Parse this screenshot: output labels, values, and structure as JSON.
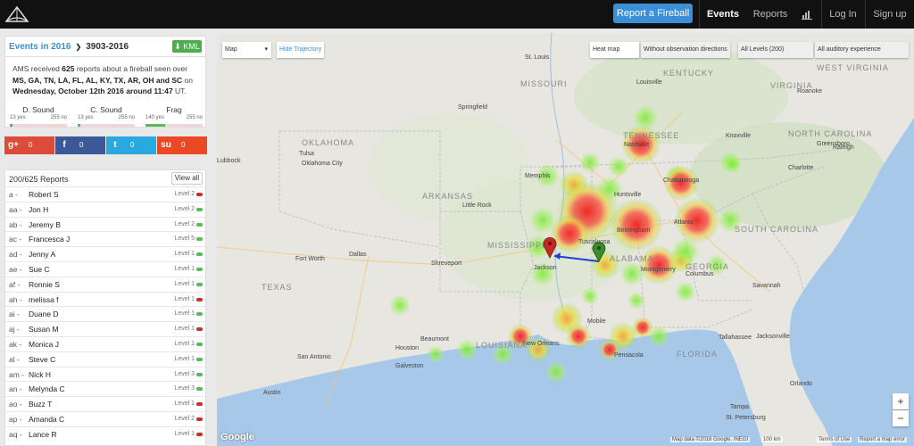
{
  "navbar": {
    "report_button": "Report a Fireball",
    "events": "Events",
    "reports": "Reports",
    "login": "Log In",
    "signup": "Sign up"
  },
  "event": {
    "link": "Events in 2016",
    "id": "3903-2016",
    "kml": "KML",
    "summary_prefix": "AMS received ",
    "count": "625",
    "summary_mid": " reports about a fireball seen over ",
    "states": "MS, GA, TN, LA, FL, AL, KY, TX, AR, OH and SC",
    "summary_on": " on ",
    "date": "Wednesday, October 12th 2016 around 11:47",
    "tz": " UT."
  },
  "meters": [
    {
      "title": "D. Sound",
      "yes": "13 yes",
      "no": "255 no",
      "fill": 0.05
    },
    {
      "title": "C. Sound",
      "yes": "13 yes",
      "no": "255 no",
      "fill": 0.05
    },
    {
      "title": "Frag",
      "yes": "140 yes",
      "no": "255 no",
      "fill": 0.35
    }
  ],
  "share": [
    {
      "icon": "g+",
      "count": "0",
      "color": "#dd4b39"
    },
    {
      "icon": "f",
      "count": "0",
      "color": "#3b5998"
    },
    {
      "icon": "t",
      "count": "0",
      "color": "#2aa9e0"
    },
    {
      "icon": "su",
      "count": "0",
      "color": "#eb4924"
    }
  ],
  "reports": {
    "title": "200/625  Reports",
    "view_all": "View all",
    "rows": [
      {
        "code": "a -",
        "name": "Robert S",
        "level": "Level 2",
        "color": "#c9302c"
      },
      {
        "code": "aa -",
        "name": "Jon H",
        "level": "Level 2",
        "color": "#5cb85c"
      },
      {
        "code": "ab -",
        "name": "Jeremy B",
        "level": "Level 2",
        "color": "#5cb85c"
      },
      {
        "code": "ac -",
        "name": "Francesca J",
        "level": "Level 5",
        "color": "#5cb85c"
      },
      {
        "code": "ad -",
        "name": "Jenny A",
        "level": "Level 1",
        "color": "#5cb85c"
      },
      {
        "code": "ae -",
        "name": "Sue C",
        "level": "Level 1",
        "color": "#5cb85c"
      },
      {
        "code": "af -",
        "name": "Ronnie S",
        "level": "Level 1",
        "color": "#5cb85c"
      },
      {
        "code": "ah -",
        "name": "melissa f",
        "level": "Level 1",
        "color": "#c9302c"
      },
      {
        "code": "ai -",
        "name": "Duane D",
        "level": "Level 1",
        "color": "#5cb85c"
      },
      {
        "code": "aj -",
        "name": "Susan M",
        "level": "Level 1",
        "color": "#c9302c"
      },
      {
        "code": "ak -",
        "name": "Monica J",
        "level": "Level 1",
        "color": "#5cb85c"
      },
      {
        "code": "al -",
        "name": "Steve C",
        "level": "Level 1",
        "color": "#5cb85c"
      },
      {
        "code": "am -",
        "name": "Nick H",
        "level": "Level 3",
        "color": "#5cb85c"
      },
      {
        "code": "an -",
        "name": "Melynda C",
        "level": "Level 3",
        "color": "#5cb85c"
      },
      {
        "code": "ao -",
        "name": "Buzz T",
        "level": "Level 1",
        "color": "#c9302c"
      },
      {
        "code": "ap -",
        "name": "Amanda C",
        "level": "Level 2",
        "color": "#c9302c"
      },
      {
        "code": "aq -",
        "name": "Lance R",
        "level": "Level 1",
        "color": "#c9302c"
      }
    ]
  },
  "map": {
    "type_select": "Map",
    "hide_trajectory": "Hide Trajectory",
    "heat_map": "Heat map",
    "without_obs": "Without observation directions",
    "all_levels": "All Levels (200)",
    "all_auditory": "All auditory experience",
    "zoom_in": "+",
    "zoom_out": "−",
    "google": "Google",
    "attrib_data": "Map data ©2016 Google, INEGI",
    "scale": "100 km",
    "terms": "Terms of Use",
    "report_error": "Report a map error",
    "states": [
      {
        "label": "MISSOURI"
      },
      {
        "label": "KENTUCKY"
      },
      {
        "label": "WEST VIRGINIA"
      },
      {
        "label": "VIRGINIA"
      },
      {
        "label": "TENNESSEE"
      },
      {
        "label": "NORTH CAROLINA"
      },
      {
        "label": "OKLAHOMA"
      },
      {
        "label": "ARKANSAS"
      },
      {
        "label": "SOUTH CAROLINA"
      },
      {
        "label": "MISSISSIPPI"
      },
      {
        "label": "ALABAMA"
      },
      {
        "label": "GEORGIA"
      },
      {
        "label": "TEXAS"
      },
      {
        "label": "LOUISIANA"
      },
      {
        "label": "FLORIDA"
      }
    ],
    "cities": [
      {
        "label": "St. Louis"
      },
      {
        "label": "Springfield"
      },
      {
        "label": "Tulsa"
      },
      {
        "label": "Oklahoma City"
      },
      {
        "label": "Nashville"
      },
      {
        "label": "Memphis"
      },
      {
        "label": "Chattanooga"
      },
      {
        "label": "Huntsville"
      },
      {
        "label": "Atlanta"
      },
      {
        "label": "Birmingham"
      },
      {
        "label": "Tuscaloosa"
      },
      {
        "label": "Jackson"
      },
      {
        "label": "Montgomery"
      },
      {
        "label": "Columbus"
      },
      {
        "label": "Dallas"
      },
      {
        "label": "Fort Worth"
      },
      {
        "label": "Shreveport"
      },
      {
        "label": "Mobile"
      },
      {
        "label": "New Orleans"
      },
      {
        "label": "Pensacola"
      },
      {
        "label": "Tallahassee"
      },
      {
        "label": "Houston"
      },
      {
        "label": "Beaumont"
      },
      {
        "label": "Austin"
      },
      {
        "label": "San Antonio"
      },
      {
        "label": "Savannah"
      },
      {
        "label": "Charlotte"
      },
      {
        "label": "Greensboro"
      },
      {
        "label": "Jacksonville"
      },
      {
        "label": "Orlando"
      },
      {
        "label": "Tampa"
      },
      {
        "label": "St. Petersburg"
      },
      {
        "label": "Raleigh"
      },
      {
        "label": "Knoxville"
      },
      {
        "label": "Lubbock"
      },
      {
        "label": "Louisville"
      },
      {
        "label": "Roanoke"
      },
      {
        "label": "Galveston"
      },
      {
        "label": "Little Rock"
      }
    ]
  }
}
